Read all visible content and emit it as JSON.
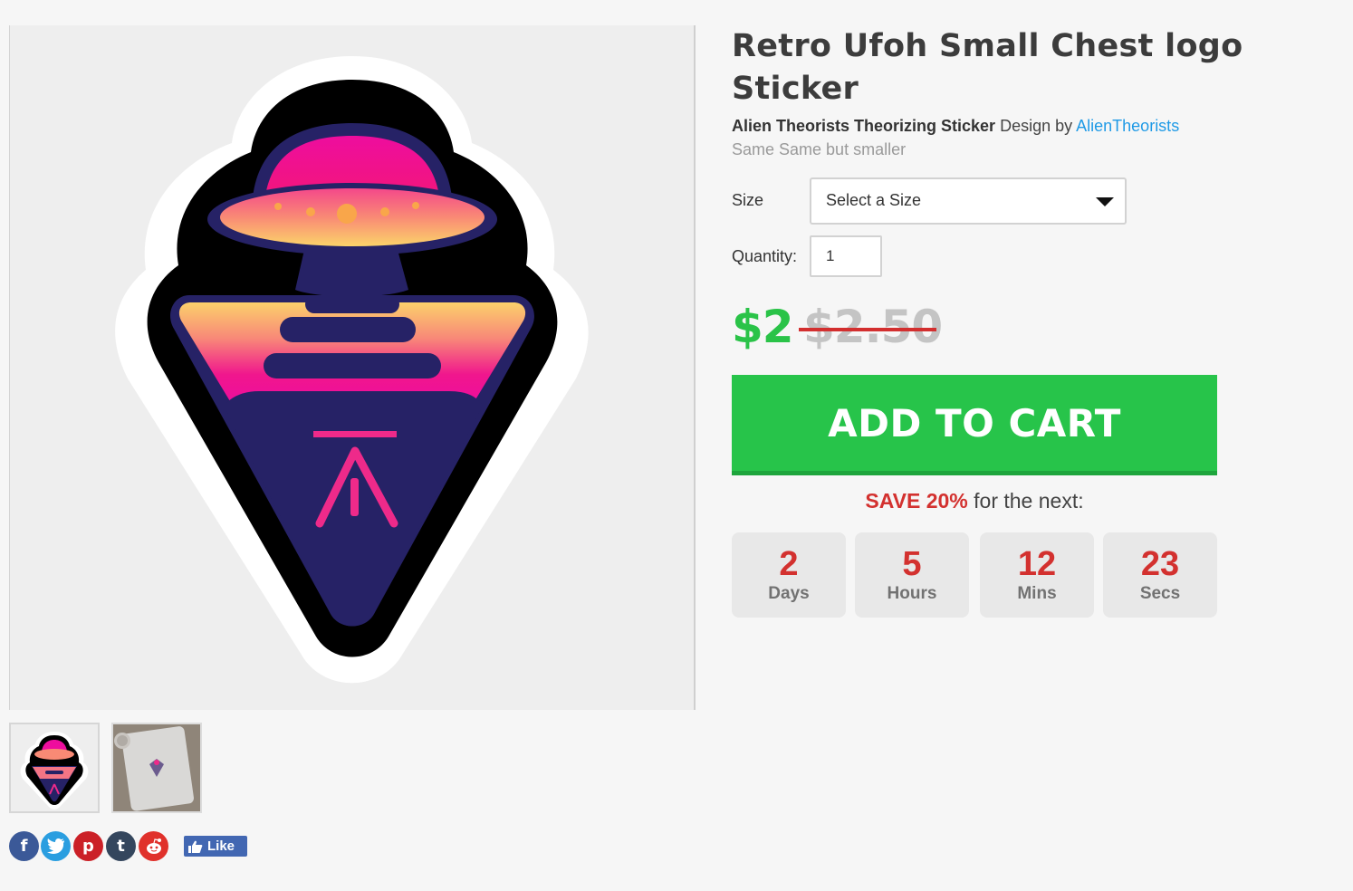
{
  "product": {
    "title": "Retro Ufoh Small Chest logo Sticker",
    "design_name": "Alien Theorists Theorizing Sticker",
    "design_by": "Design by",
    "artist": "AlienTheorists",
    "description": "Same Same but smaller"
  },
  "options": {
    "size_label": "Size",
    "size_value": "Select a Size",
    "quantity_label": "Quantity:",
    "quantity_value": "1"
  },
  "pricing": {
    "price": "$2",
    "original_price": "$2.50",
    "add_to_cart": "ADD TO CART"
  },
  "promo": {
    "save": "SAVE 20%",
    "suffix": " for the next:",
    "countdown": [
      {
        "value": "2",
        "unit": "Days"
      },
      {
        "value": "5",
        "unit": "Hours"
      },
      {
        "value": "12",
        "unit": "Mins"
      },
      {
        "value": "23",
        "unit": "Secs"
      }
    ]
  },
  "social": {
    "icons": [
      "facebook-icon",
      "twitter-icon",
      "pinterest-icon",
      "tumblr-icon",
      "reddit-icon"
    ],
    "like_label": "Like"
  },
  "colors": {
    "price_green": "#2ac348",
    "cart_green": "#27c44a",
    "promo_red": "#d3312f",
    "link_blue": "#1f9ae6"
  }
}
